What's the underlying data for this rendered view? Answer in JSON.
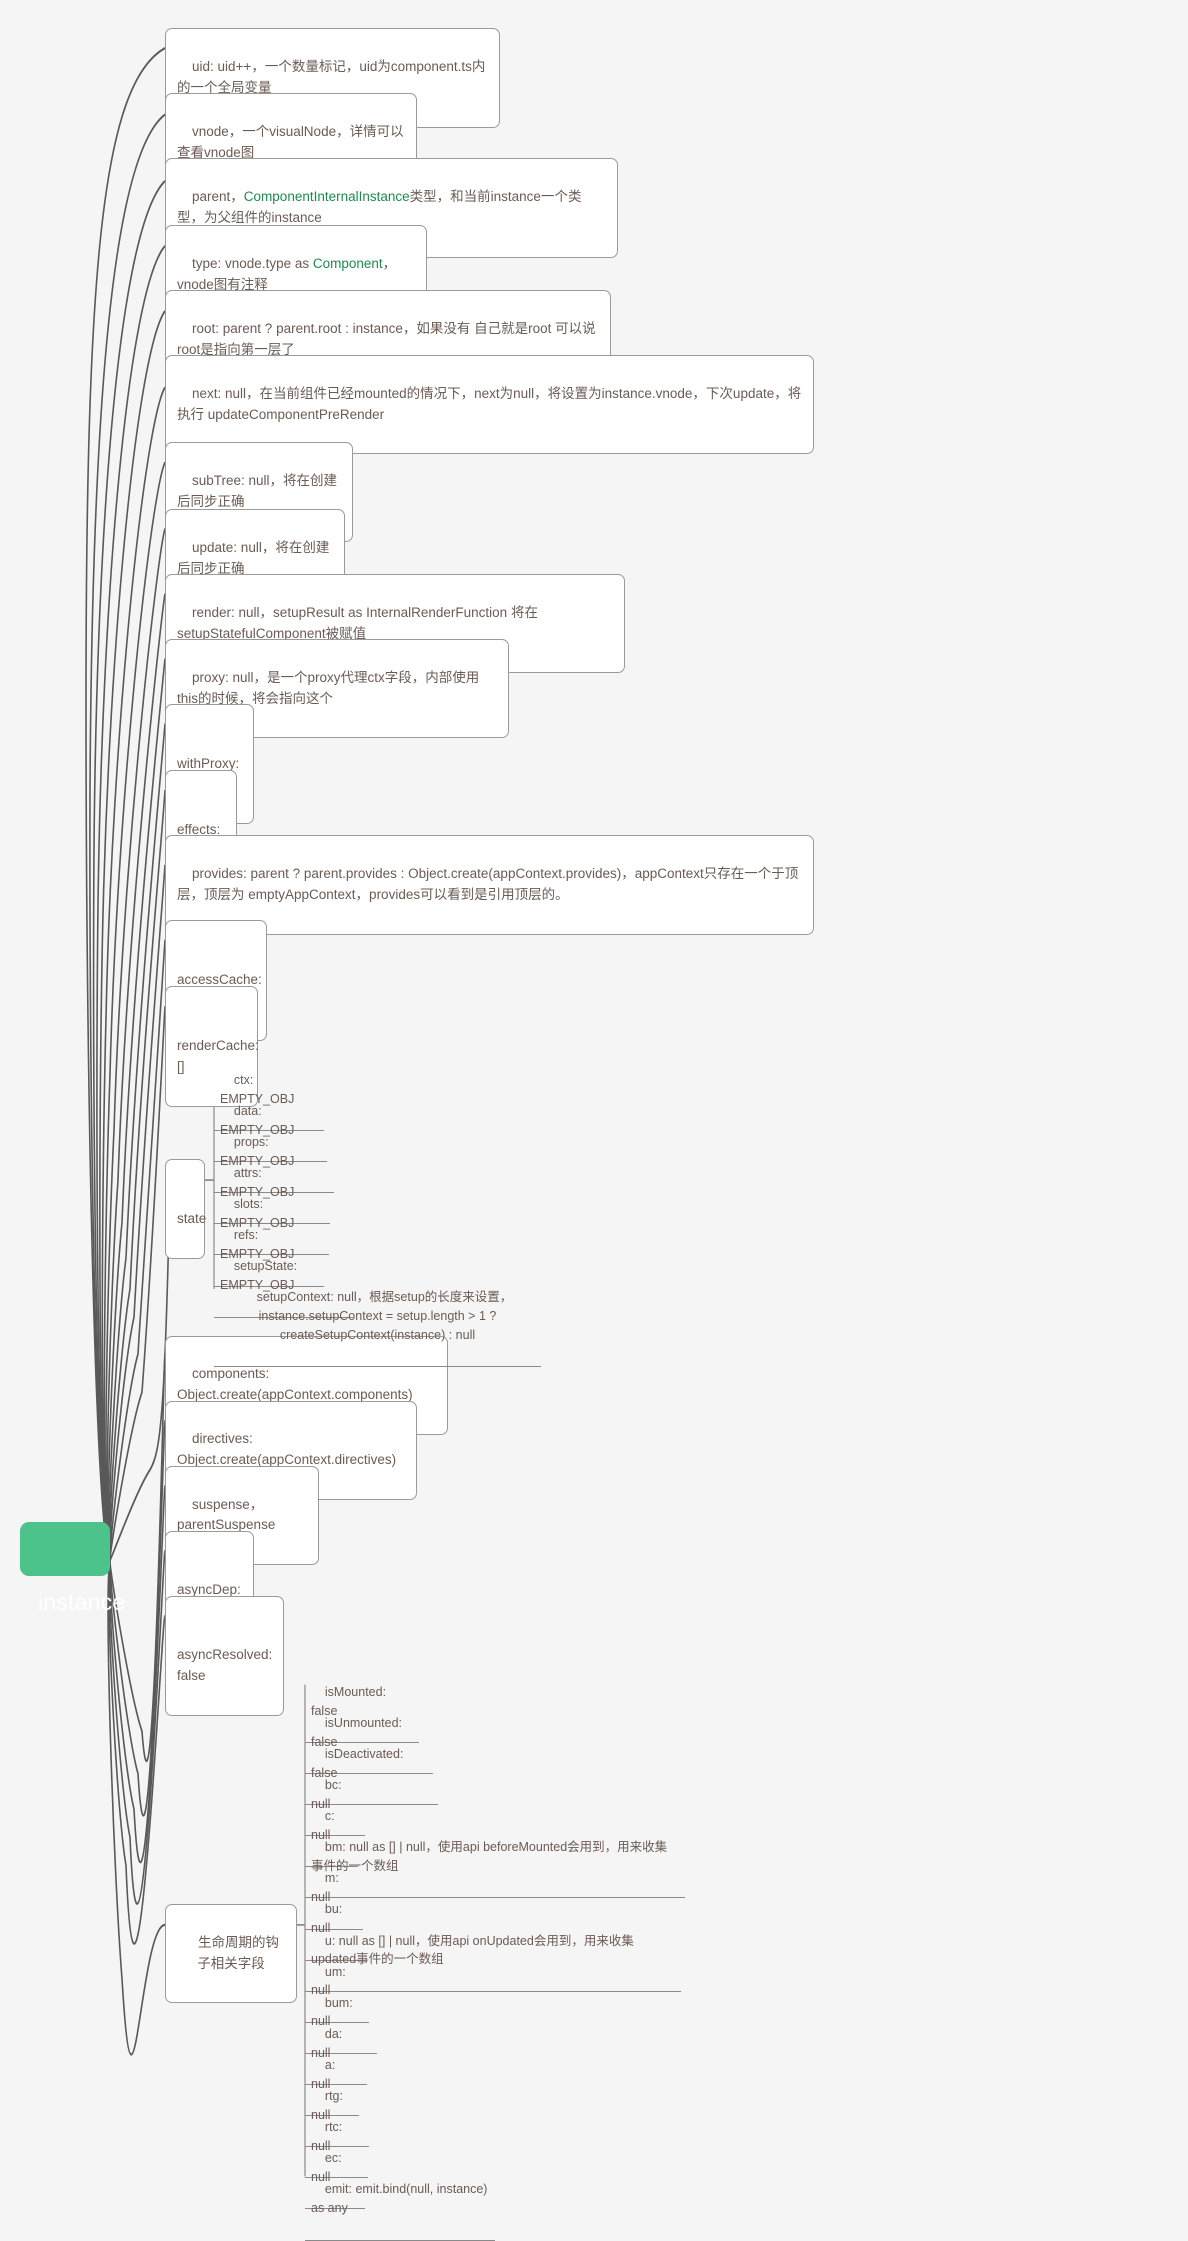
{
  "meta": {
    "background_color": "#f5f5f5",
    "node_fill": "#ffffff",
    "node_border": "#9a9a9a",
    "node_text_color": "#6b5b53",
    "root_fill": "#4cc38a",
    "root_text_color": "#ffffff",
    "accent_green": "#1f8a50",
    "link_color": "#595959"
  },
  "root": {
    "label": "instance"
  },
  "branches": [
    {
      "id": "uid",
      "text": "uid: uid++，一个数量标记，uid为component.ts内的一个全局变量"
    },
    {
      "id": "vnode",
      "text": "vnode，一个visualNode，详情可以查看vnode图"
    },
    {
      "id": "parent",
      "text_before": "parent，",
      "text_accent": "ComponentInternalInstance",
      "text_after": "类型，和当前instance一个类型，为父组件的instance"
    },
    {
      "id": "type",
      "text_before": "type: vnode.type as ",
      "text_accent": "Component",
      "text_after": "，vnode图有注释"
    },
    {
      "id": "root-field",
      "text": "root: parent ? parent.root : instance，如果没有 自己就是root 可以说root是指向第一层了"
    },
    {
      "id": "next",
      "text": "next: null，在当前组件已经mounted的情况下，next为null，将设置为instance.vnode，下次update，将执行 updateComponentPreRender"
    },
    {
      "id": "subtree",
      "text": "subTree: null，将在创建后同步正确"
    },
    {
      "id": "update",
      "text": "update: null，将在创建后同步正确"
    },
    {
      "id": "render",
      "text": "render: null，setupResult as InternalRenderFunction 将在setupStatefulComponent被赋值"
    },
    {
      "id": "proxy",
      "text": "proxy: null，是一个proxy代理ctx字段，内部使用this的时候，将会指向这个"
    },
    {
      "id": "withproxy",
      "text": "withProxy: null"
    },
    {
      "id": "effects",
      "text": "effects: null"
    },
    {
      "id": "provides",
      "text": "provides: parent ? parent.provides : Object.create(appContext.provides)，appContext只存在一个于顶层，顶层为 emptyAppContext，provides可以看到是引用顶层的。"
    },
    {
      "id": "accesscache",
      "text": "accessCache: null"
    },
    {
      "id": "rendercache",
      "text": "renderCache: []"
    },
    {
      "id": "state",
      "text": "state"
    },
    {
      "id": "components",
      "text": "components: Object.create(appContext.components)"
    },
    {
      "id": "directives",
      "text": "directives: Object.create(appContext.directives)"
    },
    {
      "id": "suspense",
      "text": "suspense，parentSuspense"
    },
    {
      "id": "asyncdep",
      "text": "asyncDep: null"
    },
    {
      "id": "asyncresolved",
      "text": "asyncResolved: false"
    },
    {
      "id": "lifecycle",
      "text": "生命周期的钩子相关字段"
    }
  ],
  "state_children": [
    {
      "text": "ctx: EMPTY_OBJ"
    },
    {
      "text": "data: EMPTY_OBJ"
    },
    {
      "text": "props: EMPTY_OBJ"
    },
    {
      "text": "attrs: EMPTY_OBJ"
    },
    {
      "text": "slots: EMPTY_OBJ"
    },
    {
      "text": "refs: EMPTY_OBJ"
    },
    {
      "text": "setupState: EMPTY_OBJ"
    },
    {
      "text": "setupContext: null，根据setup的长度来设置，instance.setupContext = setup.length > 1 ? createSetupContext(instance) : null"
    }
  ],
  "lifecycle_children": [
    {
      "text": "isMounted: false"
    },
    {
      "text": "isUnmounted: false"
    },
    {
      "text": "isDeactivated: false"
    },
    {
      "text": "bc: null"
    },
    {
      "text": "c: null"
    },
    {
      "text": "bm: null as [] | null，使用api beforeMounted会用到，用来收集事件的一个数组"
    },
    {
      "text": "m: null"
    },
    {
      "text": "bu: null"
    },
    {
      "text": "u: null as [] | null，使用api onUpdated会用到，用来收集updated事件的一个数组"
    },
    {
      "text": "um: null"
    },
    {
      "text": "bum: null"
    },
    {
      "text": "da: null"
    },
    {
      "text": "a: null"
    },
    {
      "text": "rtg: null"
    },
    {
      "text": "rtc: null"
    },
    {
      "text": "ec: null"
    },
    {
      "text": "emit: emit.bind(null, instance) as any"
    }
  ]
}
